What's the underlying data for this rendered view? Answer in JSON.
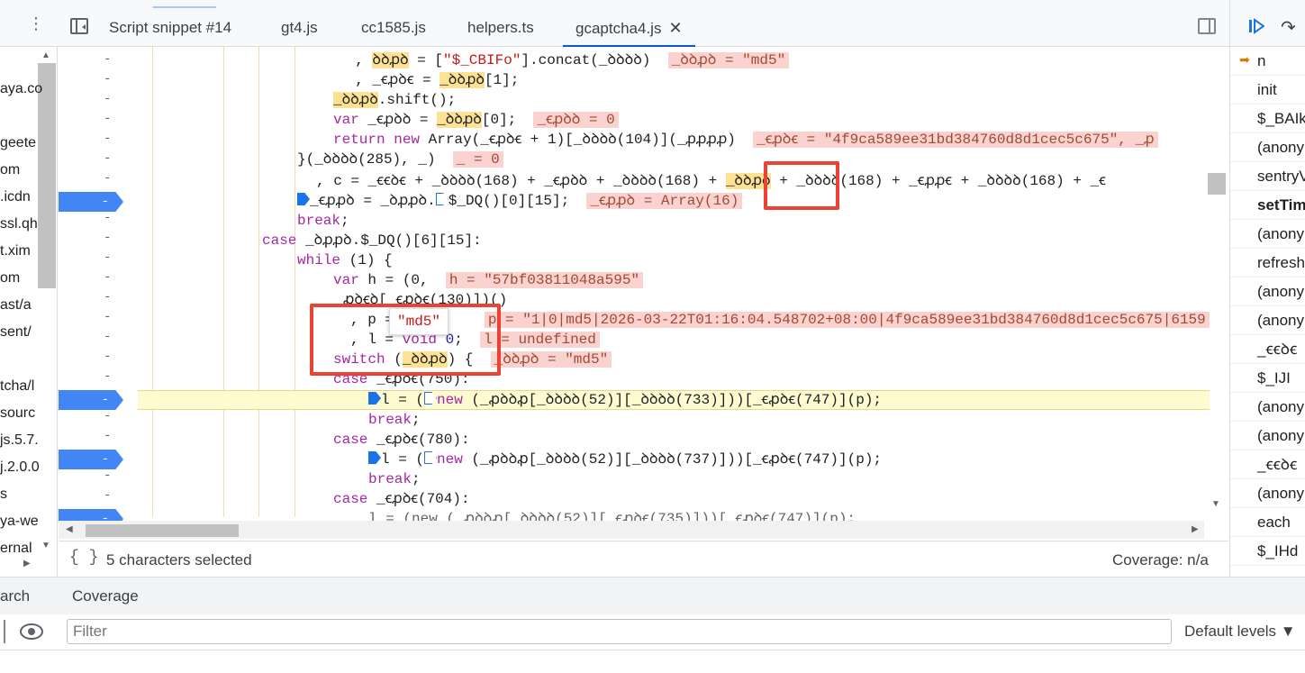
{
  "tabs": [
    {
      "label": "Script snippet #14",
      "active": false
    },
    {
      "label": "gt4.js",
      "active": false
    },
    {
      "label": "cc1585.js",
      "active": false
    },
    {
      "label": "helpers.ts",
      "active": false
    },
    {
      "label": "gcaptcha4.js",
      "active": true
    }
  ],
  "tab_close": "✕",
  "navigator": {
    "items": [
      "aya.co",
      "geete",
      "om",
      "icdn.",
      "ssl.qh",
      "t.xim",
      "om",
      "ast/a",
      "/sent",
      "",
      "tcha/l",
      "sourc",
      ".5.7.js",
      "2.0.0.j",
      "s",
      "ya-we",
      "ernal"
    ]
  },
  "gutter_marks": [
    "-",
    "-",
    "-",
    "-",
    "-",
    "-",
    "-",
    "-",
    "-",
    "-",
    "-",
    "-",
    "-",
    "-",
    "-",
    "-",
    "-",
    "-",
    "-",
    "-",
    "-",
    "-",
    "-",
    "-"
  ],
  "code": {
    "l1_pre": "  , ",
    "l1_var": "ꝺꝺꝓꝺ",
    "l1_mid": " = [",
    "l1_str": "\"$_CBIFo\"",
    "l1_post": "].concat(_ꝺꝺꝺꝺ)",
    "l1_val": "_ꝺꝺꝓꝺ = \"md5\"",
    "l2": "  , _ꞓꝓꝺꞓ = ",
    "l2_var": "_ꝺꝺꝓꝺ",
    "l2_post": "[1];",
    "l3_var": "_ꝺꝺꝓꝺ",
    "l3_post": ".shift();",
    "l4_kw": "var",
    "l4_mid": " _ꞓꝓꝺꝺ = ",
    "l4_var": "_ꝺꝺꝓꝺ",
    "l4_post": "[0];",
    "l4_val": "_ꞓꝓꝺꝺ = 0",
    "l5_kw": "return new",
    "l5_mid": " Array(_ꞓꝓꝺꞓ + 1)[_ꝺꝺꝺꝺ(104)](_ꝓꝓꝓꝓ)",
    "l5_val": "_ꞓꝓꝺꞓ = \"4f9ca589ee31bd384760d8d1cec5c675\", _ꝓ",
    "l6": "}(_ꝺꝺꝺꝺ(285), _)",
    "l6_val": "_ = 0",
    "l7_pre": ", c = _ꞓꞓꝺꞓ + _ꝺꝺꝺꝺ(168) + _ꞓꝓꝺꝺ + _ꝺꝺꝺꝺ(168) + ",
    "l7_var": "_ꝺꝺꝓꝺ",
    "l7_post": " + _ꝺꝺꝺꝺ(168) + _ꞓꝓꝓꞓ + _ꝺꝺꝺꝺ(168) + _ꞓ",
    "l8_pre": "_ꞓꝓꝓꝺ = _ꝺꝓꝓꝺ.",
    "l8_mid": "$_DQ()[0][15];",
    "l8_val": "_ꞓꝓꝓꝺ = Array(16)",
    "l9_kw": "break",
    "l10_kw": "case",
    "l10_post": " _ꝺꝓꝓꝺ.$_DQ()[6][15]:",
    "l11_kw": "while",
    "l11_post": " (1) {",
    "l12_kw": "var",
    "l12_mid": " h = (0,",
    "l12_val": "h = \"57bf03811048a595\"",
    "l13": "ꝓꝺꞓꝺ[_ꞓꝓꝺꞓ(130)])()",
    "l14_pre": ", p = ",
    "l14_val": "p = \"1|0|md5|2026-03-22T01:16:04.548702+08:00|4f9ca589ee31bd384760d8d1cec5c675|6159",
    "l15_pre": ", l = ",
    "l15_kw": "void",
    "l15_num": "0",
    "l15_val": "l = undefined",
    "l16_kw": "switch",
    "l16_var": "_ꝺꝺꝓꝺ",
    "l16_post": ") {",
    "l16_val": "_ꝺꝺꝓꝺ = \"md5\"",
    "l17_kw": "case",
    "l17_post": " _ꞓꝓꝺꞓ(750):",
    "l18_pre": "l = (",
    "l18_kw": "new",
    "l18_post": " (_ꝓꝺꝺꝓ[_ꝺꝺꝺꝺ(52)][_ꝺꝺꝺꝺ(733)]))[_ꞓꝓꝺꞓ(747)](p);",
    "l19_kw": "break",
    "l20_kw": "case",
    "l20_post": " _ꞓꝓꝺꞓ(780):",
    "l21_pre": "l = (",
    "l21_kw": "new",
    "l21_post": " (_ꝓꝺꝺꝓ[_ꝺꝺꝺꝺ(52)][_ꝺꝺꝺꝺ(737)]))[_ꞓꝓꝺꞓ(747)](p);",
    "l22_kw": "break",
    "l23_kw": "case",
    "l23_post": " _ꞓꝓꝺꞓ(704):",
    "l24": "l = (new (_ꝓꝺꝺꝓ[_ꝺꝺꝺꝺ(52)][_ꞓꝓꝺꞓ(735)]))[_ꞓꝓꝺꞓ(747)](p);"
  },
  "tooltip": "\"md5\"",
  "status": {
    "selected": "5 characters selected",
    "coverage": "Coverage: n/a"
  },
  "call_stack": [
    "n",
    "init",
    "$_BAIk",
    "(anony",
    "sentryV",
    "setTim",
    "(anony",
    "refresh",
    "(anony",
    "(anony",
    "_ꞓꞓꝺꞓ",
    "$_IJI",
    "(anony",
    "(anony",
    "_ꞓꞓꝺꞓ",
    "(anony",
    "each",
    "$_IHd"
  ],
  "drawer": {
    "tab_search": "arch",
    "tab_coverage": "Coverage",
    "filter_placeholder": "Filter",
    "levels": "Default levels ▼"
  },
  "colors": {
    "breakpoint": "#4285f4",
    "highlight_box": "#ea4335",
    "paused_line": "#fefbd1"
  }
}
